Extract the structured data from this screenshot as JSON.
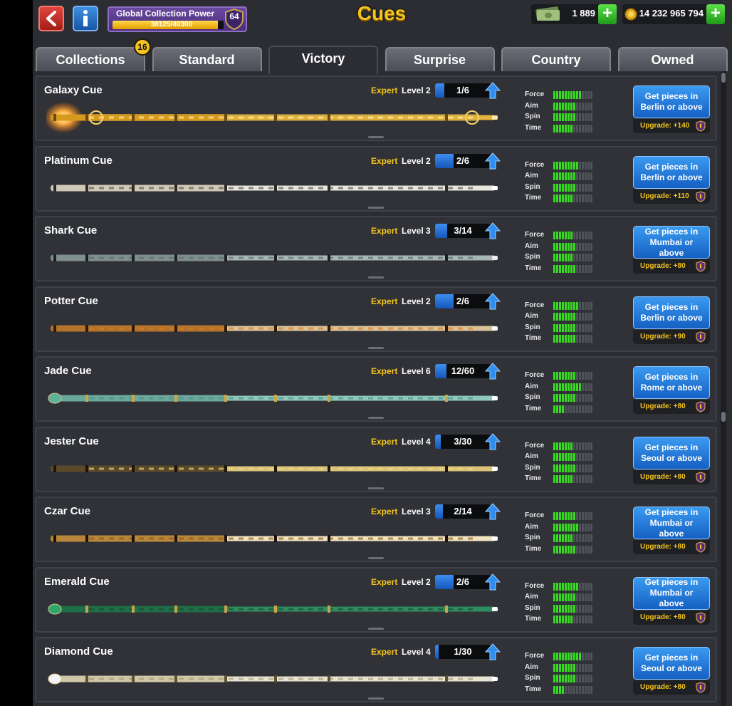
{
  "header": {
    "title": "Cues",
    "global_power_label": "Global Collection Power",
    "global_power_text": "38125/40300",
    "global_power_fraction": 0.946,
    "global_power_level": "64",
    "cash": "1 889",
    "coins": "14 232 965 794"
  },
  "tabs": [
    {
      "label": "Collections",
      "active": false
    },
    {
      "label": "Standard",
      "active": false
    },
    {
      "label": "Victory",
      "active": true
    },
    {
      "label": "Surprise",
      "active": false
    },
    {
      "label": "Country",
      "active": false
    },
    {
      "label": "Owned",
      "active": false
    }
  ],
  "collections_badge": "16",
  "stat_labels": [
    "Force",
    "Aim",
    "Spin",
    "Time"
  ],
  "expert_label": "Expert",
  "cues": [
    {
      "name": "Galaxy Cue",
      "level": "Level 2",
      "pieces": "1/6",
      "progress": 0.167,
      "stats": [
        10,
        8,
        8,
        7
      ],
      "button": "Get pieces in Berlin or above",
      "upgrade": "Upgrade: +140",
      "style": "galaxy"
    },
    {
      "name": "Platinum Cue",
      "level": "Level 2",
      "pieces": "2/6",
      "progress": 0.333,
      "stats": [
        9,
        8,
        8,
        7
      ],
      "button": "Get pieces in Berlin or above",
      "upgrade": "Upgrade: +110",
      "style": "platinum"
    },
    {
      "name": "Shark Cue",
      "level": "Level 3",
      "pieces": "3/14",
      "progress": 0.214,
      "stats": [
        7,
        8,
        7,
        8
      ],
      "button": "Get pieces in Mumbai or above",
      "upgrade": "Upgrade: +80",
      "style": "shark"
    },
    {
      "name": "Potter Cue",
      "level": "Level 2",
      "pieces": "2/6",
      "progress": 0.333,
      "stats": [
        9,
        8,
        8,
        8
      ],
      "button": "Get pieces in Berlin or above",
      "upgrade": "Upgrade: +90",
      "style": "potter"
    },
    {
      "name": "Jade Cue",
      "level": "Level 6",
      "pieces": "12/60",
      "progress": 0.2,
      "stats": [
        8,
        10,
        8,
        4
      ],
      "button": "Get pieces in Rome or above",
      "upgrade": "Upgrade: +80",
      "style": "jade"
    },
    {
      "name": "Jester Cue",
      "level": "Level 4",
      "pieces": "3/30",
      "progress": 0.1,
      "stats": [
        7,
        8,
        8,
        7
      ],
      "button": "Get pieces in Seoul or above",
      "upgrade": "Upgrade: +80",
      "style": "jester"
    },
    {
      "name": "Czar Cue",
      "level": "Level 3",
      "pieces": "2/14",
      "progress": 0.143,
      "stats": [
        8,
        9,
        7,
        8
      ],
      "button": "Get pieces in Mumbai or above",
      "upgrade": "Upgrade: +80",
      "style": "czar"
    },
    {
      "name": "Emerald Cue",
      "level": "Level 2",
      "pieces": "2/6",
      "progress": 0.333,
      "stats": [
        9,
        8,
        8,
        7
      ],
      "button": "Get pieces in Mumbai or above",
      "upgrade": "Upgrade: +80",
      "style": "emerald"
    },
    {
      "name": "Diamond Cue",
      "level": "Level 4",
      "pieces": "1/30",
      "progress": 0.033,
      "stats": [
        10,
        8,
        8,
        4
      ],
      "button": "Get pieces in Seoul or above",
      "upgrade": "Upgrade: +80",
      "style": "diamond"
    }
  ],
  "colors": {
    "accent_gold": "#f5c51d",
    "stat_on": "#39d822",
    "stat_off": "#4f5259",
    "button_blue": "#1d6fd4"
  },
  "icons": {
    "back": "back-arrow-icon",
    "info": "info-icon",
    "cash": "cash-icon",
    "coins": "coins-icon",
    "level_shield": "shield-icon",
    "upgrade_arrow": "up-arrow-icon",
    "upgrade_shield": "shield-icon"
  }
}
